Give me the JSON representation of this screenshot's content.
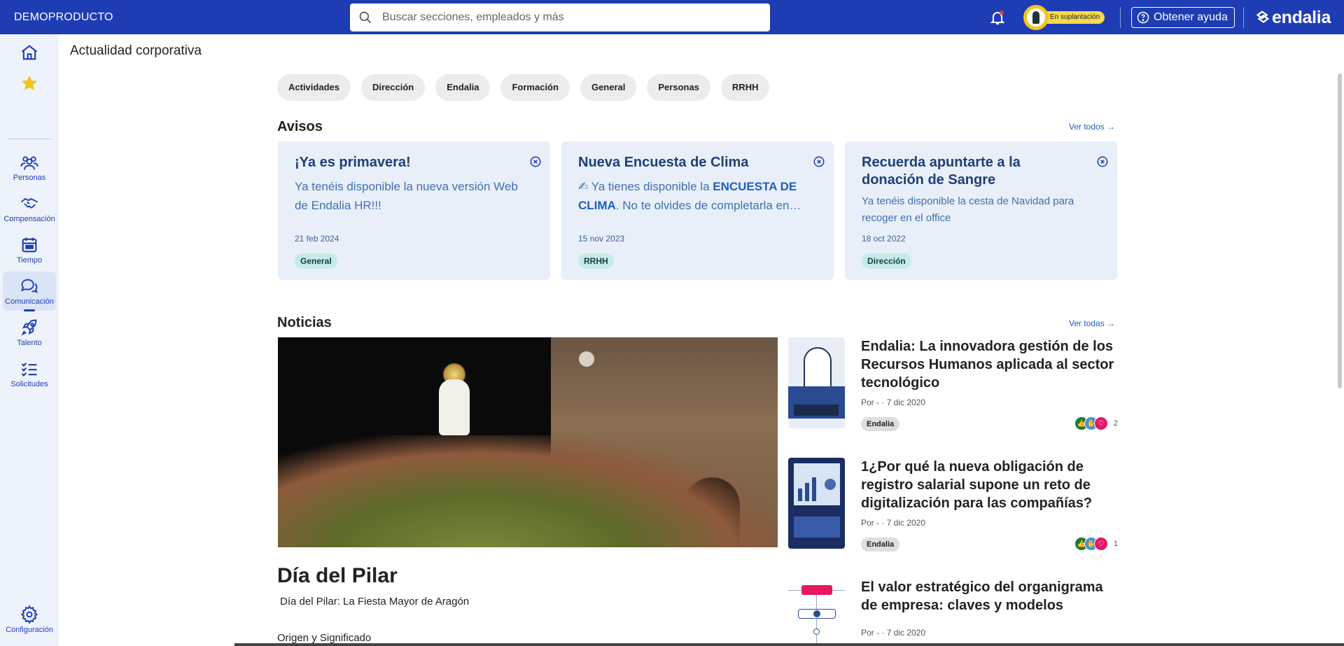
{
  "topbar": {
    "brand": "DEMOPRODUCTO",
    "search_placeholder": "Buscar secciones, empleados y más",
    "impersonation_label": "En suplantación",
    "help_label": "Obtener ayuda",
    "logo_text": "endalia"
  },
  "sidebar": {
    "items": [
      {
        "label": ""
      },
      {
        "label": ""
      },
      {
        "label": "Personas"
      },
      {
        "label": "Compensación"
      },
      {
        "label": "Tiempo"
      },
      {
        "label": "Comunicación"
      },
      {
        "label": "Talento"
      },
      {
        "label": "Solicitudes"
      },
      {
        "label": "Configuración"
      }
    ]
  },
  "page": {
    "title": "Actualidad corporativa"
  },
  "categories": [
    "Actividades",
    "Dirección",
    "Endalia",
    "Formación",
    "General",
    "Personas",
    "RRHH"
  ],
  "avisos": {
    "title": "Avisos",
    "see_all": "Ver todos →",
    "items": [
      {
        "title": "¡Ya es primavera!",
        "body": "Ya tenéis disponible la nueva versión Web de Endalia HR!!!",
        "date": "21 feb 2024",
        "tag": "General"
      },
      {
        "title": "Nueva Encuesta de Clima",
        "body_prefix": "Ya tienes disponible la ",
        "body_bold": "ENCUESTA DE CLIMA",
        "body_suffix": ". No te olvides de completarla en…",
        "date": "15 nov 2023",
        "tag": "RRHH"
      },
      {
        "title": "Recuerda apuntarte a la donación de Sangre",
        "body": "Ya tenéis disponible la cesta de Navidad para recoger en el office",
        "date": "18 oct 2022",
        "tag": "Dirección"
      }
    ]
  },
  "noticias": {
    "title": "Noticias",
    "see_all": "Ver todas →",
    "featured": {
      "title": "Día del Pilar",
      "subtitle": "Día del Pilar: La Fiesta Mayor de Aragón",
      "section": "Origen y Significado"
    },
    "items": [
      {
        "title": "Endalia: La innovadora gestión de los Recursos Humanos aplicada al sector tecnológico",
        "meta": "Por - · 7 dic 2020",
        "tag": "Endalia",
        "reactions": "2"
      },
      {
        "title": "1¿Por qué la nueva obligación de registro salarial supone un reto de digitalización para las compañías?",
        "meta": "Por - · 7 dic 2020",
        "tag": "Endalia",
        "reactions": "1"
      },
      {
        "title": "El valor estratégico del organigrama de empresa: claves y modelos",
        "meta": "Por - · 7 dic 2020"
      }
    ]
  },
  "colors": {
    "brand": "#1e3cb4",
    "sidebar_bg": "#eef3fb",
    "aviso_bg": "#e8eff9",
    "tag_teal": "#c4ebe8"
  }
}
